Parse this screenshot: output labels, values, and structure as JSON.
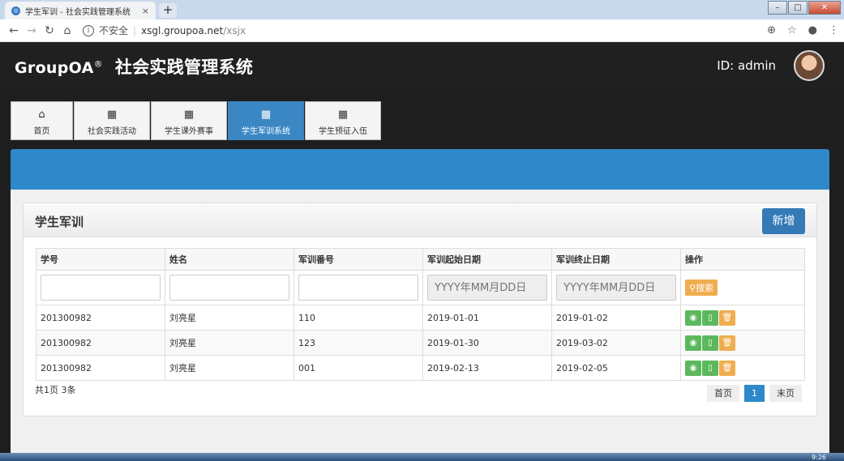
{
  "browser": {
    "tab_title": "学生军训 - 社会实践管理系统",
    "tab_close": "×",
    "new_tab": "+",
    "url_secure_label": "不安全",
    "url_host": "xsgl.groupoa.net",
    "url_path": "/xsjx"
  },
  "header": {
    "brand": "GroupOA",
    "registered": "®",
    "system_name": "社会实践管理系统",
    "user_id": "ID: admin"
  },
  "nav": {
    "tabs": [
      {
        "label": "首页",
        "icon": "home-icon",
        "active": false
      },
      {
        "label": "社会实践活动",
        "icon": "grid-icon",
        "active": false
      },
      {
        "label": "学生课外赛事",
        "icon": "grid-icon",
        "active": false
      },
      {
        "label": "学生军训系统",
        "icon": "grid-icon",
        "active": true
      },
      {
        "label": "学生预征入伍",
        "icon": "grid-icon",
        "active": false
      }
    ]
  },
  "panel": {
    "title": "学生军训",
    "new_button": "新增"
  },
  "table": {
    "headers": [
      "学号",
      "姓名",
      "军训番号",
      "军训起始日期",
      "军训终止日期",
      "操作"
    ],
    "date_placeholder": "YYYY年MM月DD日",
    "search_button": "搜索",
    "rows": [
      {
        "student_no": "201300982",
        "name": "刘亮星",
        "train_no": "110",
        "start": "2019-01-01",
        "end": "2019-01-02"
      },
      {
        "student_no": "201300982",
        "name": "刘亮星",
        "train_no": "123",
        "start": "2019-01-30",
        "end": "2019-03-02"
      },
      {
        "student_no": "201300982",
        "name": "刘亮星",
        "train_no": "001",
        "start": "2019-02-13",
        "end": "2019-02-05"
      }
    ]
  },
  "pagination": {
    "summary": "共1页 3条",
    "first": "首页",
    "current": "1",
    "last": "末页"
  },
  "taskbar": {
    "clock": "9:26"
  },
  "colors": {
    "primary_blue": "#337ab7",
    "band_blue": "#2e88c9",
    "warning_orange": "#f0ad4e",
    "success_green": "#5cb85c",
    "header_dark": "#202020"
  }
}
